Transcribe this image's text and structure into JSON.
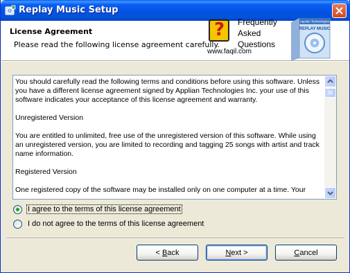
{
  "window": {
    "title": "Replay Music Setup",
    "close_icon": "close-icon",
    "app_icon": "setup-installer-icon"
  },
  "header": {
    "title": "License Agreement",
    "subtitle": "Please read the following license agreement carefully."
  },
  "faq_logo": {
    "mark": "?",
    "line1": "Frequently",
    "line2": "Asked",
    "line3": "Questions",
    "url": "www.faqil.com"
  },
  "product_box": {
    "vendor": "Applian Technologies",
    "name": "REPLAY MUSIC"
  },
  "license": {
    "paragraphs": [
      "You should carefully read the following terms and conditions before using this software. Unless you have a different license agreement signed by Applian Technologies Inc. your use of this software indicates your acceptance of this license agreement and warranty.",
      "Unregistered Version",
      "You are entitled to unlimited, free use of the unregistered version of this software. While using an unregistered version, you are limited to recording and tagging 25 songs with artist and track name information.",
      "Registered Version",
      "One registered copy of the software may be installed only on one computer at a time.  Your"
    ]
  },
  "options": {
    "agree": "I agree to the terms of this license agreement",
    "disagree": "I do not agree to the terms of this license agreement",
    "selected": "agree"
  },
  "buttons": {
    "back_prefix": "< ",
    "back_key": "B",
    "back_rest": "ack",
    "next_key": "N",
    "next_rest": "ext >",
    "cancel_key": "C",
    "cancel_rest": "ancel"
  },
  "colors": {
    "titlebar": "#0553e1",
    "dialog_bg": "#ece9d8",
    "radio_check": "#21a121"
  }
}
